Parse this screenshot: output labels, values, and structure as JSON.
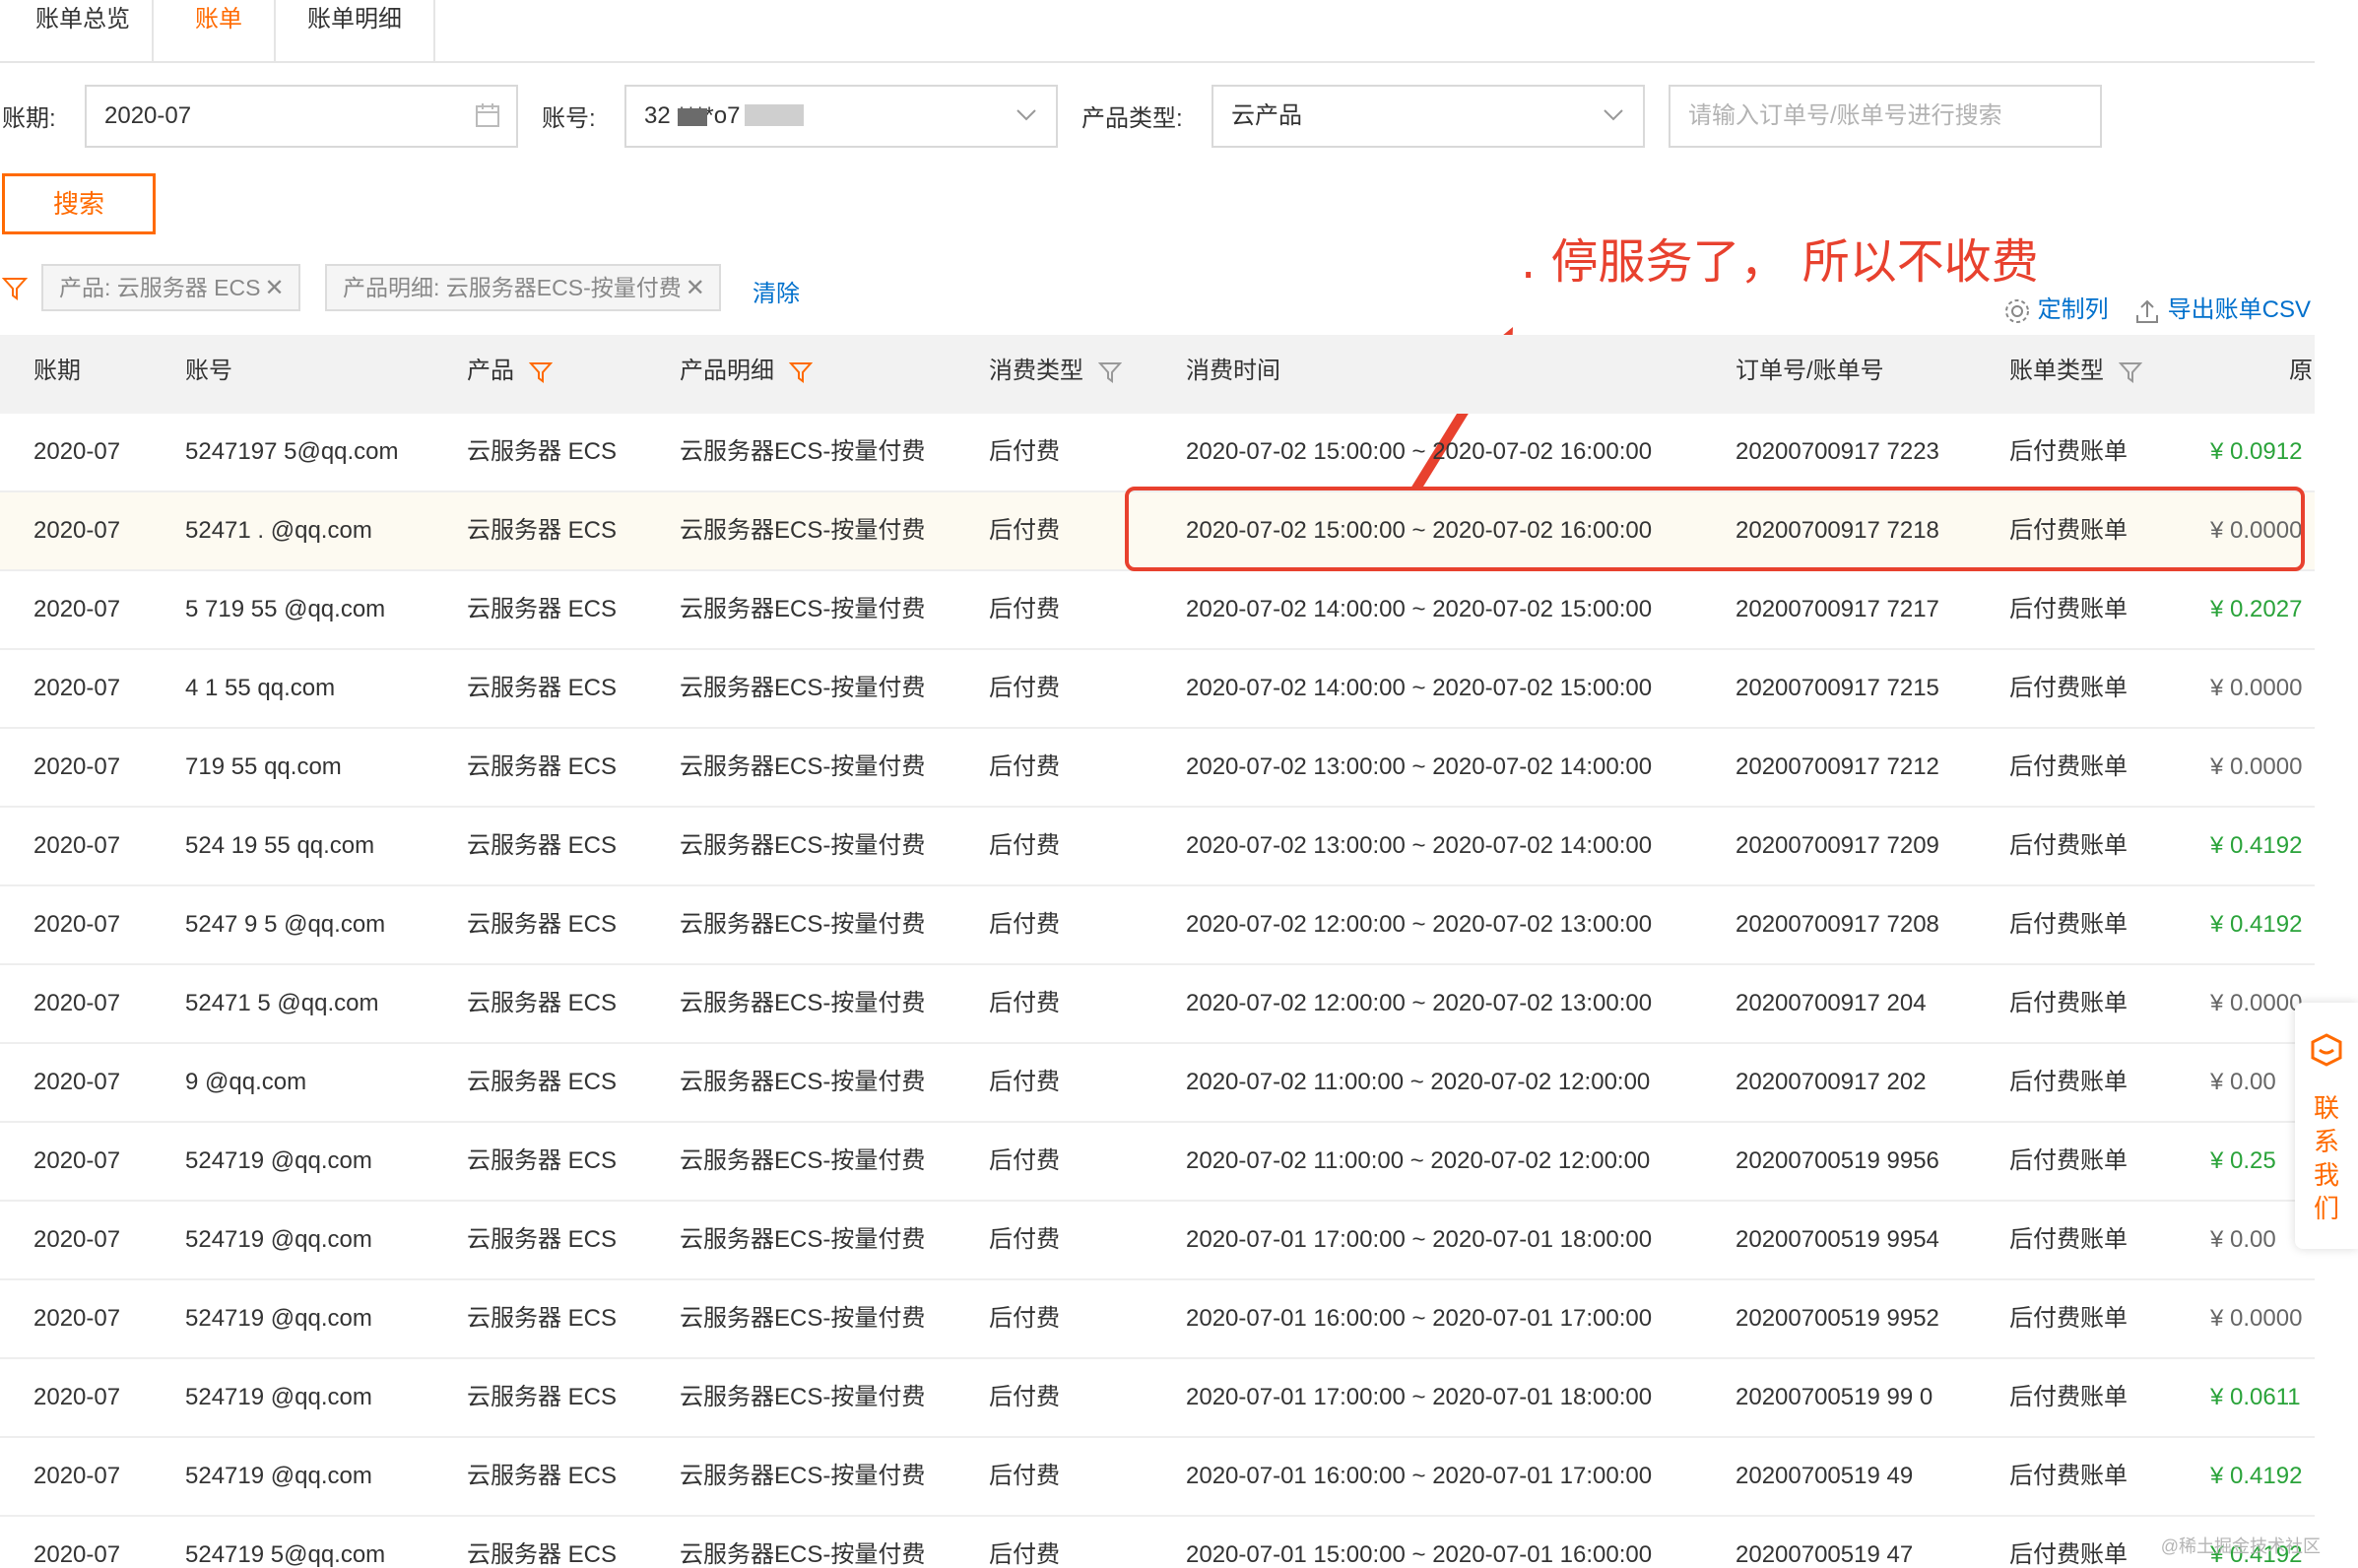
{
  "tabs": [
    {
      "label": "账单总览",
      "active": false
    },
    {
      "label": "账单",
      "active": true
    },
    {
      "label": "账单明细",
      "active": false
    }
  ],
  "filters": {
    "period_label": "账期:",
    "period_value": "2020-07",
    "account_label": "账号:",
    "account_value": "32 ****o7 *** m",
    "product_type_label": "产品类型:",
    "product_type_value": "云产品",
    "search_placeholder": "请输入订单号/账单号进行搜索",
    "search_button": "搜索"
  },
  "active_filters": {
    "chips": [
      "产品: 云服务器 ECS",
      "产品明细: 云服务器ECS-按量付费"
    ],
    "clear_label": "清除"
  },
  "annotation": {
    "text": ". 停服务了， 所以不收费",
    "color": "#e8412e"
  },
  "toolbar": {
    "customize_label": "定制列",
    "export_label": "导出账单CSV"
  },
  "table": {
    "headers": {
      "period": "账期",
      "account": "账号",
      "product": "产品",
      "product_detail": "产品明细",
      "consume_type": "消费类型",
      "consume_time": "消费时间",
      "order_no": "订单号/账单号",
      "bill_type": "账单类型",
      "original": "原"
    },
    "rows": [
      {
        "period": "2020-07",
        "account": "5247197  5@qq.com",
        "product": "云服务器 ECS",
        "detail": "云服务器ECS-按量付费",
        "type": "后付费",
        "time": "2020-07-02 15:00:00  ~  2020-07-02 16:00:00",
        "order": "20200700917  7223",
        "bill_type": "后付费账单",
        "amount": "¥ 0.0912",
        "green": true
      },
      {
        "period": "2020-07",
        "account": "52471  .  @qq.com",
        "product": "云服务器 ECS",
        "detail": "云服务器ECS-按量付费",
        "type": "后付费",
        "time": "2020-07-02 15:00:00  ~  2020-07-02 16:00:00",
        "order": "20200700917  7218",
        "bill_type": "后付费账单",
        "amount": "¥ 0.0000",
        "green": false,
        "highlight": true
      },
      {
        "period": "2020-07",
        "account": "5  719  55  @qq.com",
        "product": "云服务器 ECS",
        "detail": "云服务器ECS-按量付费",
        "type": "后付费",
        "time": "2020-07-02 14:00:00  ~  2020-07-02 15:00:00",
        "order": "20200700917  7217",
        "bill_type": "后付费账单",
        "amount": "¥ 0.2027",
        "green": true
      },
      {
        "period": "2020-07",
        "account": "4  1  55  qq.com",
        "product": "云服务器 ECS",
        "detail": "云服务器ECS-按量付费",
        "type": "后付费",
        "time": "2020-07-02 14:00:00  ~  2020-07-02 15:00:00",
        "order": "20200700917  7215",
        "bill_type": "后付费账单",
        "amount": "¥ 0.0000",
        "green": false
      },
      {
        "period": "2020-07",
        "account": "  719  55  qq.com",
        "product": "云服务器 ECS",
        "detail": "云服务器ECS-按量付费",
        "type": "后付费",
        "time": "2020-07-02 13:00:00  ~  2020-07-02 14:00:00",
        "order": "20200700917  7212",
        "bill_type": "后付费账单",
        "amount": "¥ 0.0000",
        "green": false
      },
      {
        "period": "2020-07",
        "account": "524  19  55  qq.com",
        "product": "云服务器 ECS",
        "detail": "云服务器ECS-按量付费",
        "type": "后付费",
        "time": "2020-07-02 13:00:00  ~  2020-07-02 14:00:00",
        "order": "20200700917  7209",
        "bill_type": "后付费账单",
        "amount": "¥ 0.4192",
        "green": true
      },
      {
        "period": "2020-07",
        "account": "5247  9  5  @qq.com",
        "product": "云服务器 ECS",
        "detail": "云服务器ECS-按量付费",
        "type": "后付费",
        "time": "2020-07-02 12:00:00  ~  2020-07-02 13:00:00",
        "order": "20200700917  7208",
        "bill_type": "后付费账单",
        "amount": "¥ 0.4192",
        "green": true
      },
      {
        "period": "2020-07",
        "account": "52471  5  @qq.com",
        "product": "云服务器 ECS",
        "detail": "云服务器ECS-按量付费",
        "type": "后付费",
        "time": "2020-07-02 12:00:00  ~  2020-07-02 13:00:00",
        "order": "20200700917  204",
        "bill_type": "后付费账单",
        "amount": "¥ 0.0000",
        "green": false
      },
      {
        "period": "2020-07",
        "account": "  9  @qq.com",
        "product": "云服务器 ECS",
        "detail": "云服务器ECS-按量付费",
        "type": "后付费",
        "time": "2020-07-02 11:00:00  ~  2020-07-02 12:00:00",
        "order": "20200700917  202",
        "bill_type": "后付费账单",
        "amount": "¥ 0.00",
        "green": false
      },
      {
        "period": "2020-07",
        "account": "524719  @qq.com",
        "product": "云服务器 ECS",
        "detail": "云服务器ECS-按量付费",
        "type": "后付费",
        "time": "2020-07-02 11:00:00  ~  2020-07-02 12:00:00",
        "order": "20200700519  9956",
        "bill_type": "后付费账单",
        "amount": "¥ 0.25",
        "green": true
      },
      {
        "period": "2020-07",
        "account": "524719  @qq.com",
        "product": "云服务器 ECS",
        "detail": "云服务器ECS-按量付费",
        "type": "后付费",
        "time": "2020-07-01 17:00:00  ~  2020-07-01 18:00:00",
        "order": "20200700519  9954",
        "bill_type": "后付费账单",
        "amount": "¥ 0.00",
        "green": false
      },
      {
        "period": "2020-07",
        "account": "524719  @qq.com",
        "product": "云服务器 ECS",
        "detail": "云服务器ECS-按量付费",
        "type": "后付费",
        "time": "2020-07-01 16:00:00  ~  2020-07-01 17:00:00",
        "order": "20200700519  9952",
        "bill_type": "后付费账单",
        "amount": "¥ 0.0000",
        "green": false
      },
      {
        "period": "2020-07",
        "account": "524719  @qq.com",
        "product": "云服务器 ECS",
        "detail": "云服务器ECS-按量付费",
        "type": "后付费",
        "time": "2020-07-01 17:00:00  ~  2020-07-01 18:00:00",
        "order": "20200700519  99  0",
        "bill_type": "后付费账单",
        "amount": "¥ 0.0611",
        "green": true
      },
      {
        "period": "2020-07",
        "account": "524719  @qq.com",
        "product": "云服务器 ECS",
        "detail": "云服务器ECS-按量付费",
        "type": "后付费",
        "time": "2020-07-01 16:00:00  ~  2020-07-01 17:00:00",
        "order": "20200700519  49",
        "bill_type": "后付费账单",
        "amount": "¥ 0.4192",
        "green": true
      },
      {
        "period": "2020-07",
        "account": "524719  5@qq.com",
        "product": "云服务器 ECS",
        "detail": "云服务器ECS-按量付费",
        "type": "后付费",
        "time": "2020-07-01 15:00:00  ~  2020-07-01 16:00:00",
        "order": "20200700519  47",
        "bill_type": "后付费账单",
        "amount": "¥ 0.4192",
        "green": true
      }
    ]
  },
  "contact": {
    "label": "联系我们"
  },
  "watermark": "@稀土掘金技术社区"
}
